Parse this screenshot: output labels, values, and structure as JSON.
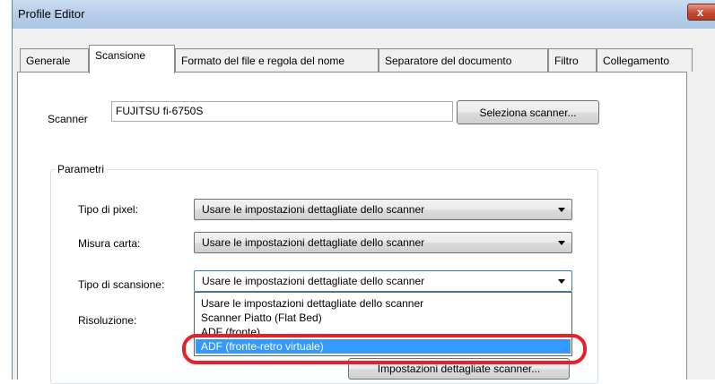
{
  "window": {
    "title": "Profile Editor",
    "close_glyph": "x"
  },
  "tabs": [
    {
      "label": "Generale",
      "active": false
    },
    {
      "label": "Scansione",
      "active": true
    },
    {
      "label": "Formato del file e regola del nome",
      "active": false
    },
    {
      "label": "Separatore del documento",
      "active": false
    },
    {
      "label": "Filtro",
      "active": false
    },
    {
      "label": "Collegamento",
      "active": false
    }
  ],
  "scanner": {
    "label": "Scanner",
    "value": "FUJITSU fi-6750S",
    "select_button": "Seleziona scanner..."
  },
  "parametri": {
    "legend": "Parametri",
    "pixel_type": {
      "label": "Tipo di pixel:",
      "value": "Usare le impostazioni dettagliate dello scanner"
    },
    "paper_size": {
      "label": "Misura carta:",
      "value": "Usare le impostazioni dettagliate dello scanner"
    },
    "scan_type": {
      "label": "Tipo di scansione:",
      "value": "Usare le impostazioni dettagliate dello scanner"
    },
    "resolution": {
      "label": "Risoluzione:"
    },
    "detail_button": "Impostazioni dettagliate scanner..."
  },
  "scan_type_options": [
    "Usare le impostazioni dettagliate dello scanner",
    "Scanner Piatto (Flat Bed)",
    "ADF (fronte)",
    "ADF (fronte-retro virtuale)"
  ],
  "selected_option_index": 3,
  "colors": {
    "selection": "#3399ff",
    "highlight_ring": "#e8202a"
  }
}
